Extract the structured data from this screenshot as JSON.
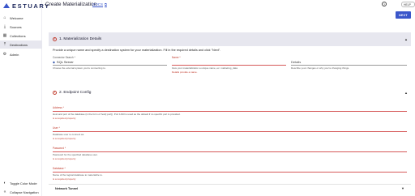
{
  "app": {
    "logo_text": "ESTUARY",
    "page_title": "Create Materialization",
    "docs_label": "DOCS",
    "help_label": "HELP",
    "next_label": "NEXT"
  },
  "sidebar": {
    "items": [
      {
        "label": "Welcome",
        "icon": "home-icon"
      },
      {
        "label": "Sources",
        "icon": "sources-icon"
      },
      {
        "label": "Collections",
        "icon": "collections-icon"
      },
      {
        "label": "Destinations",
        "icon": "destinations-icon"
      },
      {
        "label": "Admin",
        "icon": "gear-icon"
      }
    ],
    "bottom": [
      {
        "label": "Toggle Color Mode",
        "icon": "color-mode-icon"
      },
      {
        "label": "Collapse Navigation",
        "icon": "collapse-icon"
      }
    ]
  },
  "details": {
    "title": "1. Materialization Details",
    "description": "Provide a unique name and specify a destination system for your materialization. Fill in the required details and click \"Next\".",
    "connector": {
      "label": "Connector Search *",
      "value": "SQL Server",
      "helper": "Choose the external system you're connecting to."
    },
    "name": {
      "label": "Name *",
      "value": "",
      "helper": "Give your materialization a unique name, ex: marketing_data",
      "error": "Details provide a name."
    },
    "details_field": {
      "label": "",
      "value": "Details",
      "helper": "Describe your changes or why you're changing things."
    }
  },
  "endpoint": {
    "title": "2. Endpoint Config",
    "fields": [
      {
        "label": "Address *",
        "helper": "Host and port of the database (in the form of host[:port]). Port 1433 is used as the default if no specific port is provided.",
        "error": "is a required property"
      },
      {
        "label": "User *",
        "helper": "Database user to connect as.",
        "error": "is a required property"
      },
      {
        "label": "Password *",
        "helper": "Password for the specified database user.",
        "error": "is a required property"
      },
      {
        "label": "Database *",
        "helper": "Name of the logical database to materialize to.",
        "error": "is a required property"
      }
    ],
    "network_tunnel": "Network Tunnel"
  }
}
